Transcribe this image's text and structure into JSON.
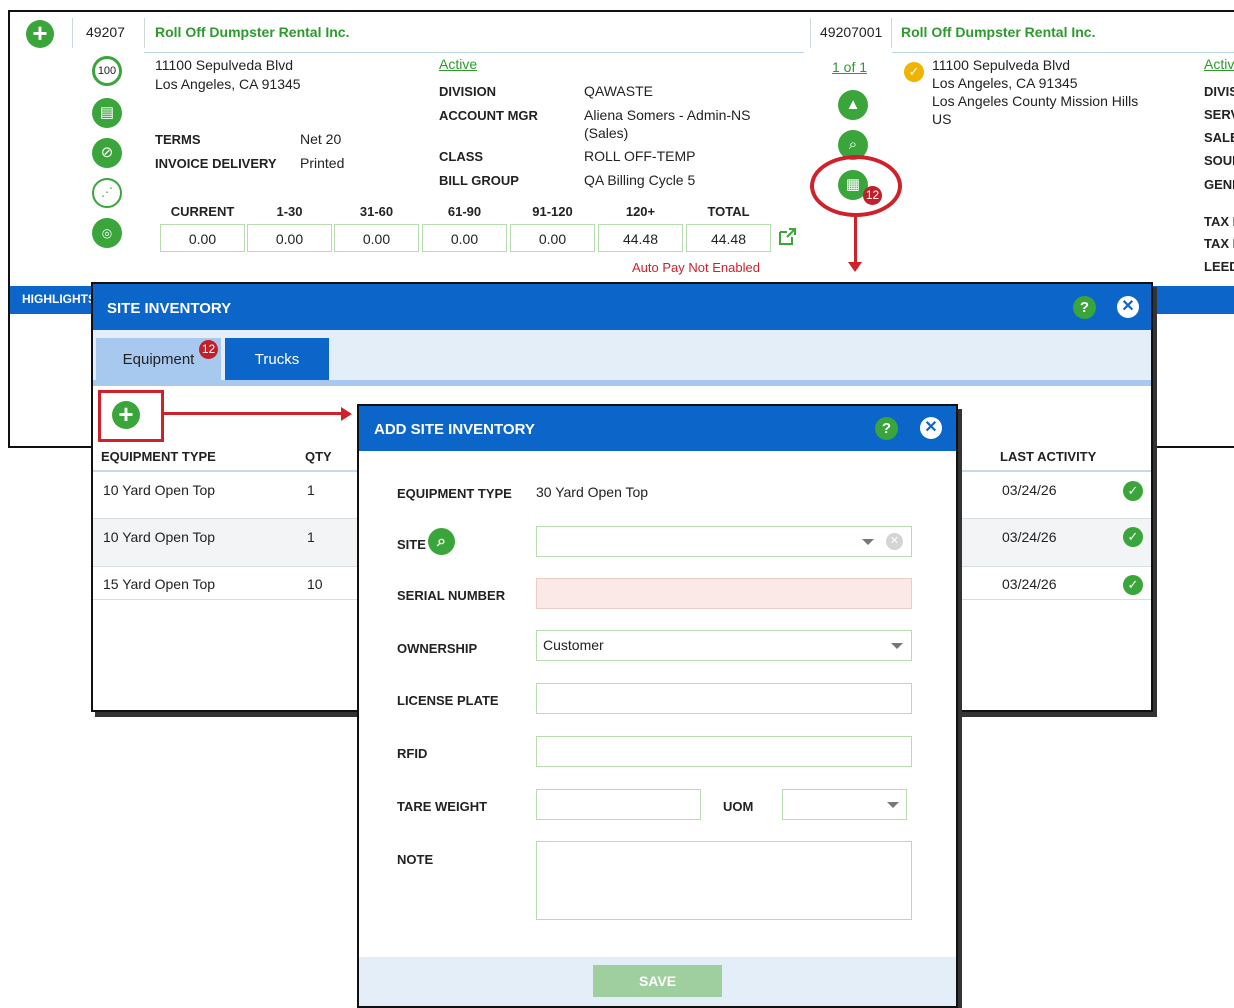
{
  "account": {
    "id": "49207",
    "name": "Roll Off Dumpster Rental Inc.",
    "address1": "11100 Sepulveda Blvd",
    "address2": "Los Angeles, CA 91345",
    "status": "Active",
    "terms_label": "TERMS",
    "terms_value": "Net 20",
    "invoice_delivery_label": "INVOICE DELIVERY",
    "invoice_delivery_value": "Printed",
    "division_label": "DIVISION",
    "division_value": "QAWASTE",
    "account_mgr_label": "ACCOUNT MGR",
    "account_mgr_value": "Aliena Somers - Admin-NS",
    "account_mgr_value2": "(Sales)",
    "class_label": "CLASS",
    "class_value": "ROLL OFF-TEMP",
    "bill_group_label": "BILL GROUP",
    "bill_group_value": "QA Billing Cycle 5",
    "score": "100",
    "autopay": "Auto Pay Not Enabled"
  },
  "aging": {
    "headers": [
      "CURRENT",
      "1-30",
      "31-60",
      "61-90",
      "91-120",
      "120+",
      "TOTAL"
    ],
    "values": [
      "0.00",
      "0.00",
      "0.00",
      "0.00",
      "0.00",
      "44.48",
      "44.48"
    ]
  },
  "site": {
    "id": "49207001",
    "name": "Roll Off Dumpster Rental Inc.",
    "pager": "1 of 1",
    "address1": "11100 Sepulveda Blvd",
    "address2": "Los Angeles, CA 91345",
    "address3": "Los Angeles County Mission Hills",
    "address4": "US",
    "status": "Active",
    "inventory_badge": "12",
    "right_labels": [
      "DIVISION",
      "SERVICE",
      "SALES",
      "SOURCE",
      "GENERAL",
      "TAX EXEMPT",
      "TAX ID",
      "LEED"
    ]
  },
  "highlight_label": "HIGHLIGHTS",
  "site_inventory": {
    "title": "SITE INVENTORY",
    "tabs": [
      {
        "label": "Equipment",
        "badge": "12"
      },
      {
        "label": "Trucks"
      }
    ],
    "columns": {
      "equipment_type": "EQUIPMENT TYPE",
      "qty": "QTY",
      "last_activity": "LAST ACTIVITY"
    },
    "rows": [
      {
        "equipment_type": "10 Yard Open Top",
        "qty": "1",
        "last_activity": "03/24/26"
      },
      {
        "equipment_type": "10 Yard Open Top",
        "qty": "1",
        "last_activity": "03/24/26"
      },
      {
        "equipment_type": "15 Yard Open Top",
        "qty": "10",
        "last_activity": "03/24/26"
      }
    ]
  },
  "add_site_inventory": {
    "title": "ADD SITE INVENTORY",
    "equipment_type_label": "EQUIPMENT TYPE",
    "equipment_type_value": "30 Yard Open Top",
    "site_label": "SITE",
    "site_value": "",
    "serial_number_label": "SERIAL NUMBER",
    "serial_number_value": "",
    "ownership_label": "OWNERSHIP",
    "ownership_value": "Customer",
    "license_plate_label": "LICENSE PLATE",
    "rfid_label": "RFID",
    "tare_weight_label": "TARE WEIGHT",
    "uom_label": "UOM",
    "note_label": "NOTE",
    "save_label": "SAVE"
  },
  "colors": {
    "accent_green": "#3aa53a",
    "header_blue": "#0c66c9",
    "callout_red": "#d0202a",
    "required_field": "#fbe9e7"
  }
}
